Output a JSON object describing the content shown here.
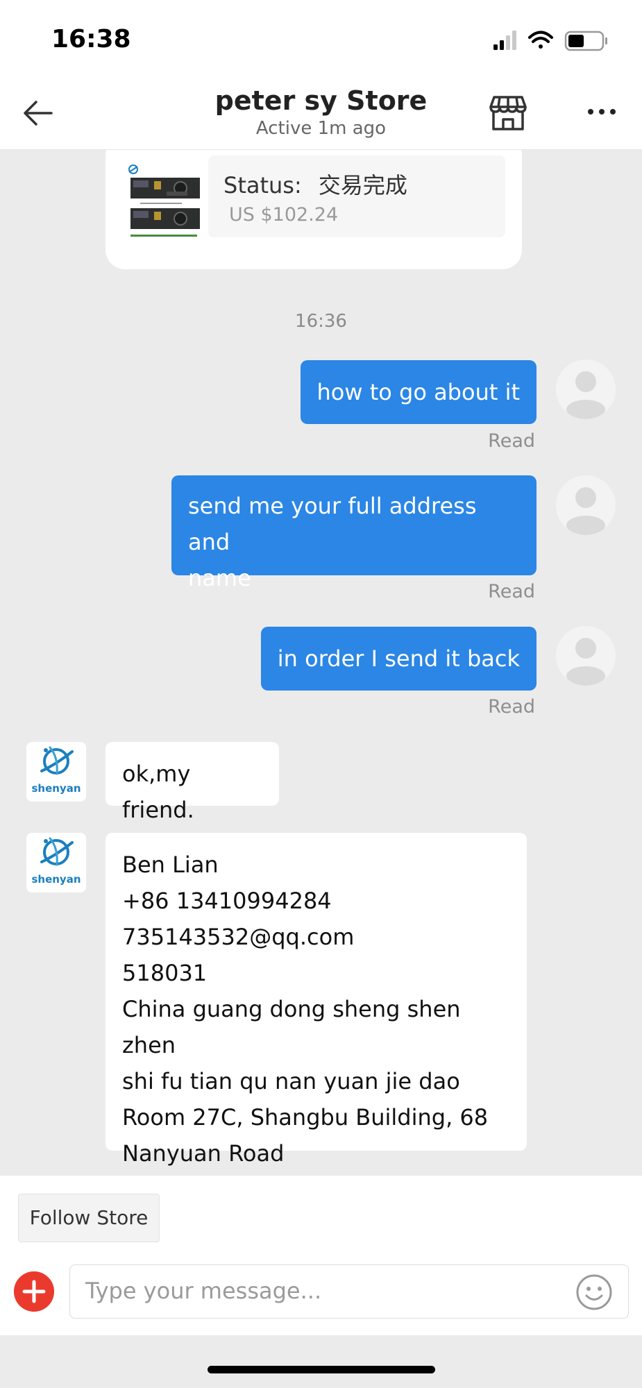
{
  "status_bar": {
    "time": "16:38"
  },
  "header": {
    "title": "peter sy Store",
    "subtitle": "Active 1m ago"
  },
  "order": {
    "status_label": "Status:",
    "status_value": "交易完成",
    "price": "US $102.24"
  },
  "chat": {
    "time_divider": "16:36",
    "messages": [
      {
        "sender": "user",
        "text": "how to go about it",
        "receipt": "Read"
      },
      {
        "sender": "user",
        "lines": [
          "send me your full address and",
          "name"
        ],
        "receipt": "Read"
      },
      {
        "sender": "user",
        "text": "in order I send it back",
        "receipt": "Read"
      },
      {
        "sender": "store",
        "text": "ok,my friend."
      },
      {
        "sender": "store",
        "lines": [
          "Ben Lian",
          "+86 13410994284",
          "735143532@qq.com",
          "518031",
          "China guang dong sheng shen zhen",
          "shi fu tian qu nan yuan jie dao",
          "Room 27C, Shangbu Building, 68",
          "Nanyuan Road"
        ]
      }
    ],
    "store_logo_text": "shenyan"
  },
  "footer": {
    "follow_label": "Follow Store",
    "input_placeholder": "Type your message..."
  },
  "colors": {
    "accent": "#2b86e5",
    "add_button": "#ea3a2e",
    "logo": "#1a7fbf"
  },
  "icons": [
    "back-arrow-icon",
    "store-icon",
    "more-icon",
    "plus-icon",
    "emoji-icon",
    "signal-icon",
    "wifi-icon",
    "battery-icon"
  ]
}
